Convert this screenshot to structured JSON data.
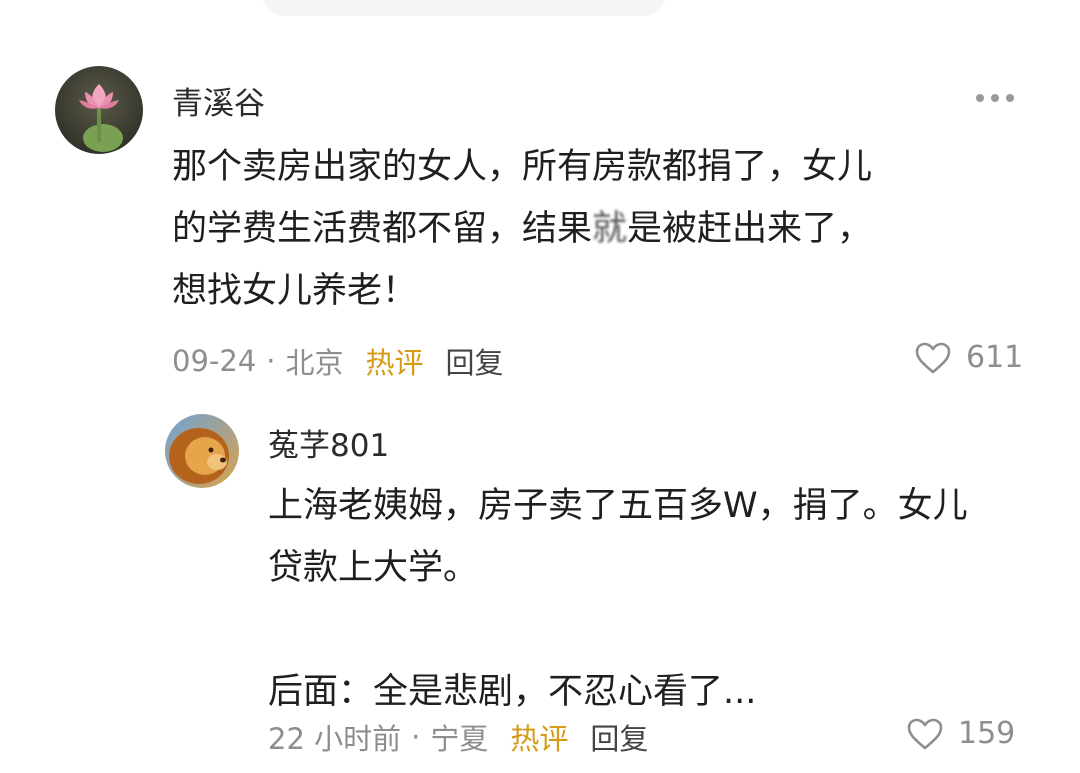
{
  "comments": [
    {
      "username": "青溪谷",
      "lines": [
        "那个卖房出家的女人，所有房款都捐了，女儿",
        "的学费生活费都不留，结果",
        "是被赶出来了，",
        "想找女儿养老！"
      ],
      "blurred_char": "就",
      "date": "09-24",
      "separator": "·",
      "location": "北京",
      "hot_label": "热评",
      "reply_label": "回复",
      "likes": "611",
      "avatar_icon": "lotus-avatar"
    },
    {
      "username": "菟芓801",
      "lines": [
        "上海老姨姆，房子卖了五百多W，捐了。女儿",
        "贷款上大学。",
        "",
        "后面：全是悲剧，不忍心看了..."
      ],
      "date": "22 小时前",
      "separator": "·",
      "location": "宁夏",
      "hot_label": "热评",
      "reply_label": "回复",
      "likes": "159",
      "avatar_icon": "lion-avatar"
    }
  ],
  "colors": {
    "hot": "#d69a16",
    "meta": "#8e8e8e",
    "text": "#1f1f1f"
  }
}
